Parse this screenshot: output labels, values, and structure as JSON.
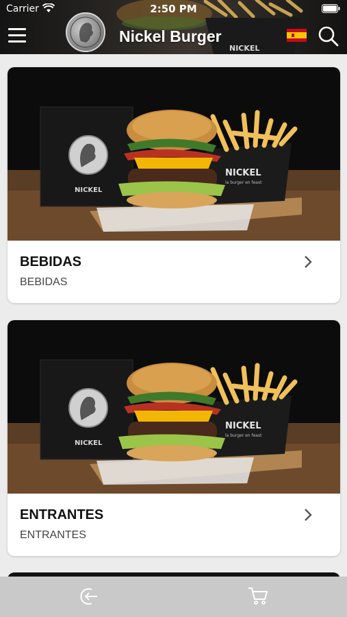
{
  "status_bar": {
    "carrier": "Carrier",
    "time": "2:50 PM"
  },
  "header": {
    "title": "Nickel Burger",
    "menu_icon": "hamburger-menu-icon",
    "language_icon": "spain-flag-icon",
    "search_icon": "search-icon",
    "background_image_text": "NICKEL"
  },
  "categories": [
    {
      "title": "BEBIDAS",
      "subtitle": "BEBIDAS",
      "image_box_text": "NICKEL",
      "image_bucket_text": "NICKEL",
      "image_bucket_tagline": "la burger en feast"
    },
    {
      "title": "ENTRANTES",
      "subtitle": "ENTRANTES",
      "image_box_text": "NICKEL",
      "image_bucket_text": "NICKEL",
      "image_bucket_tagline": "la burger en feast"
    }
  ],
  "bottom_bar": {
    "exit_icon": "exit-icon",
    "cart_icon": "shopping-cart-icon"
  },
  "colors": {
    "header_bg": "#2a2724",
    "page_bg": "#ececec",
    "card_bg": "#ffffff",
    "bottom_bar_bg": "#c9c9c9",
    "accent_cheese": "#f2b705"
  }
}
